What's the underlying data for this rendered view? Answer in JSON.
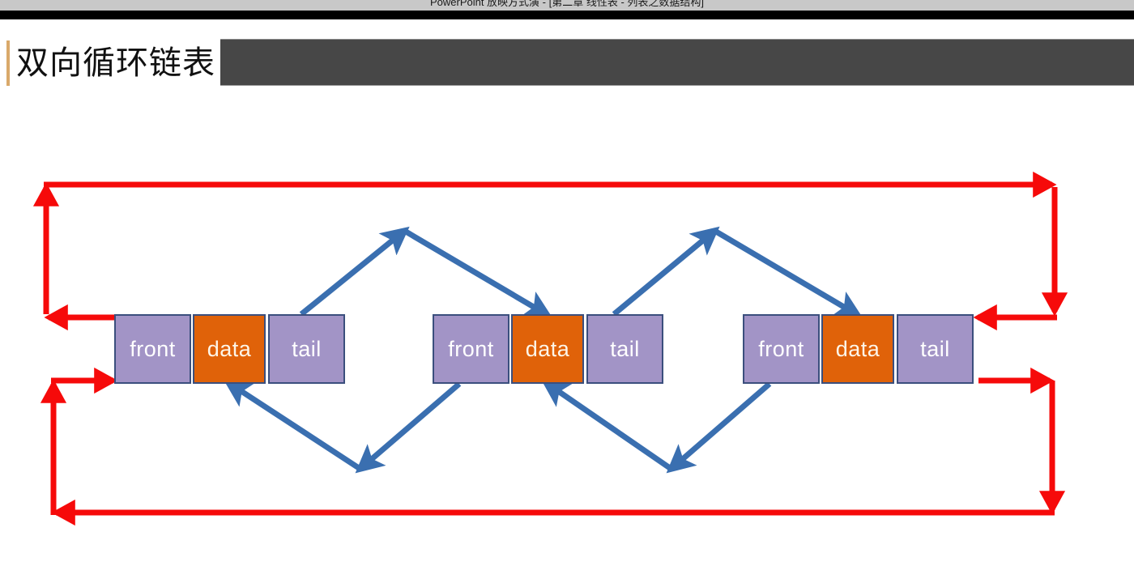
{
  "window": {
    "app_titlebar_text": "PowerPoint 放映方式演 - [第二章 线性表 - 列表之数据结构]"
  },
  "slide": {
    "title": "双向循环链表",
    "title_accent_color": "#d9a96a",
    "header_band_color": "#474747"
  },
  "palette": {
    "node_pointer_fill": "#a294c6",
    "node_data_fill": "#e06209",
    "node_border": "#3b4f7d",
    "blue_arrow": "#3a6fb0",
    "red_arrow": "#f60a0a",
    "background": "#ffffff"
  },
  "diagram": {
    "kind": "doubly-circular-linked-list",
    "node_count": 3,
    "cell_labels": {
      "front": "front",
      "data": "data",
      "tail": "tail"
    },
    "nodes": [
      {
        "id": "node-1",
        "front": "front",
        "data": "data",
        "tail": "tail"
      },
      {
        "id": "node-2",
        "front": "front",
        "data": "data",
        "tail": "tail"
      },
      {
        "id": "node-3",
        "front": "front",
        "data": "data",
        "tail": "tail"
      }
    ],
    "blue_links": [
      {
        "id": "next-1-2-up",
        "from": "node-1.tail",
        "to": "apex-1",
        "direction": "up-right"
      },
      {
        "id": "next-1-2-down",
        "from": "apex-1",
        "to": "node-2.data",
        "direction": "down-right"
      },
      {
        "id": "next-2-3-up",
        "from": "node-2.tail",
        "to": "apex-2",
        "direction": "up-right"
      },
      {
        "id": "next-2-3-down",
        "from": "apex-2",
        "to": "node-3.data",
        "direction": "down-right"
      },
      {
        "id": "prev-2-1-down",
        "from": "node-2.front",
        "to": "valley-1",
        "direction": "down-left"
      },
      {
        "id": "prev-2-1-up",
        "from": "valley-1",
        "to": "node-1.data",
        "direction": "up-left"
      },
      {
        "id": "prev-3-2-down",
        "from": "node-3.front",
        "to": "valley-2",
        "direction": "down-left"
      },
      {
        "id": "prev-3-2-up",
        "from": "valley-2",
        "to": "node-2.data",
        "direction": "up-left"
      }
    ],
    "red_links": [
      {
        "id": "wrap-tail-to-head-top",
        "from": "node-3.tail",
        "to": "node-1.front",
        "path": "right-up-left-down-left"
      },
      {
        "id": "wrap-head-to-tail-bottom",
        "from": "node-1.front",
        "to": "node-3.tail",
        "path": "left-down-right-up-right"
      }
    ]
  }
}
